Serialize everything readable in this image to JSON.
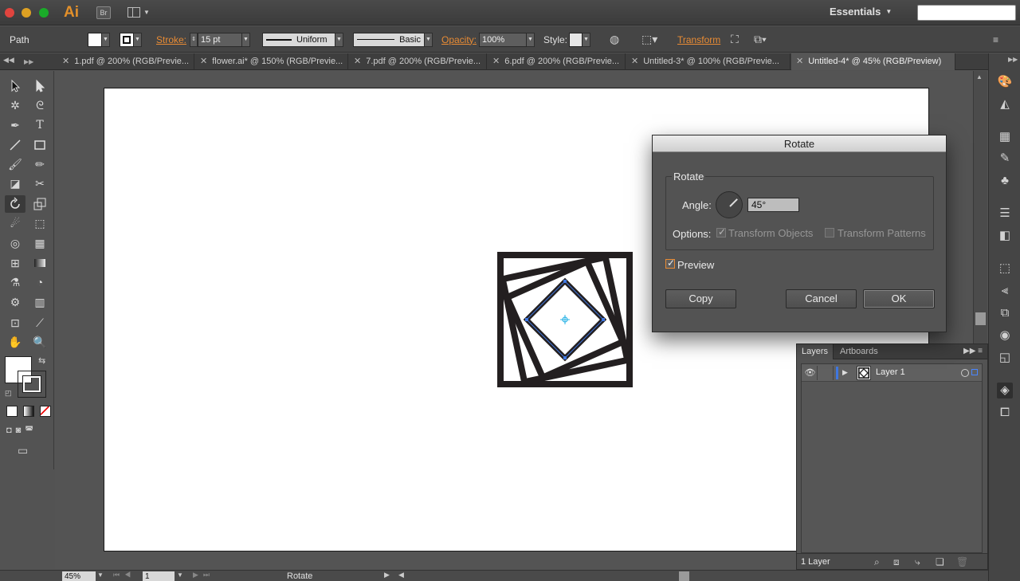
{
  "app": {
    "logo": "Ai",
    "bridge": "Br",
    "workspace": "Essentials",
    "search_placeholder": ""
  },
  "control": {
    "selection_type": "Path",
    "stroke_label": "Stroke:",
    "stroke_weight": "15 pt",
    "profile": "Uniform",
    "brush": "Basic",
    "opacity_label": "Opacity:",
    "opacity": "100%",
    "style_label": "Style:",
    "transform_label": "Transform"
  },
  "tabs": [
    {
      "label": "1.pdf @ 200% (RGB/Previe..."
    },
    {
      "label": "flower.ai* @ 150% (RGB/Previe..."
    },
    {
      "label": "7.pdf @ 200% (RGB/Previe..."
    },
    {
      "label": "6.pdf @ 200% (RGB/Previe..."
    },
    {
      "label": "Untitled-3* @ 100% (RGB/Previe..."
    },
    {
      "label": "Untitled-4* @ 45% (RGB/Preview)"
    }
  ],
  "status": {
    "zoom": "45%",
    "page": "1",
    "tool": "Rotate"
  },
  "dialog": {
    "title": "Rotate",
    "group_title": "Rotate",
    "angle_label": "Angle:",
    "angle_value": "45°",
    "options_label": "Options:",
    "transform_objects": "Transform Objects",
    "transform_patterns": "Transform Patterns",
    "preview": "Preview",
    "copy": "Copy",
    "cancel": "Cancel",
    "ok": "OK"
  },
  "layers": {
    "tab_layers": "Layers",
    "tab_artboards": "Artboards",
    "layer_name": "Layer 1",
    "count": "1 Layer",
    "layer_color": "#3f77e0"
  },
  "colors": {
    "accent": "#e88b34",
    "selection": "#3f77e0"
  }
}
